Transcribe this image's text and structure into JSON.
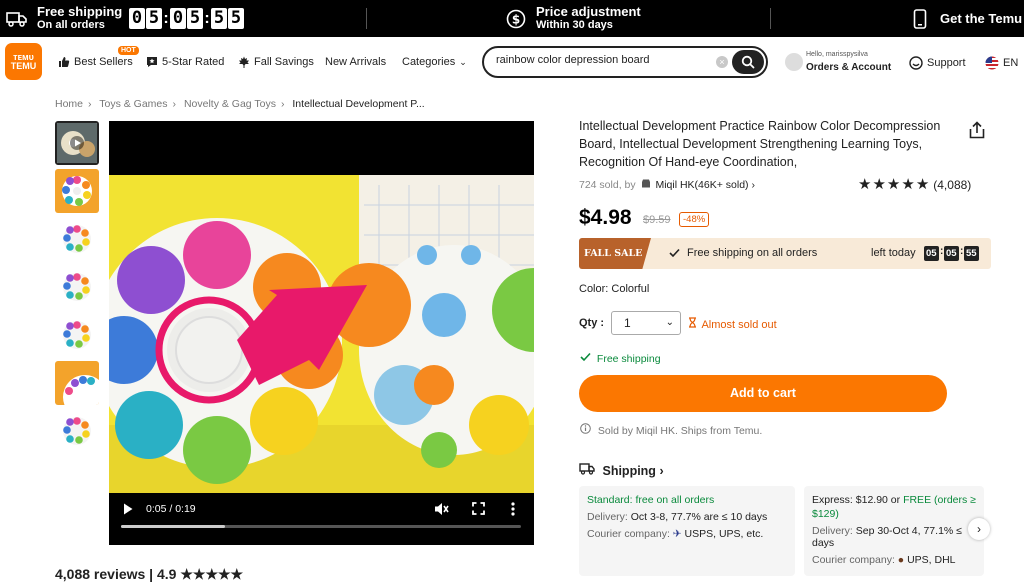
{
  "promo_bar": {
    "shipping_title": "Free shipping",
    "shipping_sub": "On all orders",
    "timer": [
      "0",
      "5",
      "0",
      "5",
      "5",
      "5"
    ],
    "price_title": "Price adjustment",
    "price_sub": "Within 30 days",
    "app_label": "Get the Temu"
  },
  "nav": {
    "logo_top": "ᴛᴇᴍᴜ",
    "logo_bottom": "TEMU",
    "hot": "HOT",
    "best_sellers": "Best Sellers",
    "five_star": "5-Star Rated",
    "fall_savings": "Fall Savings",
    "new_arrivals": "New Arrivals",
    "categories": "Categories",
    "search_value": "rainbow color depression board",
    "account_hello": "Hello, marisspysilva",
    "account_main": "Orders & Account",
    "support": "Support",
    "language": "EN"
  },
  "breadcrumb": [
    "Home",
    "Toys & Games",
    "Novelty & Gag Toys",
    "Intellectual Development P..."
  ],
  "video": {
    "time": "0:05 / 0:19",
    "progress": 0.26
  },
  "product": {
    "title": "Intellectual Development Practice Rainbow Color Decompression Board, Intellectual Development Strengthening Learning Toys, Recognition Of Hand-eye Coordination,",
    "sold": "724 sold, by",
    "store": "Miqil HK(46K+ sold)",
    "rating_count": "(4,088)",
    "stars": 5,
    "price": "$4.98",
    "old_price": "$9.59",
    "discount": "-48%",
    "sale_badge": "FALL SALE",
    "sale_free": "Free shipping on all orders",
    "left_today": "left today",
    "left_timer": [
      "05",
      "05",
      "55"
    ],
    "color_label": "Color: Colorful",
    "qty_label": "Qty :",
    "qty_value": "1",
    "almost_sold": "Almost sold out",
    "free_shipping": "Free shipping",
    "add_to_cart": "Add to cart",
    "sold_by": "Sold by Miqil HK. Ships from Temu."
  },
  "shipping": {
    "heading": "Shipping",
    "standard": {
      "title": "Standard: free on all orders",
      "delivery_label": "Delivery:",
      "delivery": "Oct 3-8, 77.7% are ≤ 10 days",
      "courier_label": "Courier company:",
      "couriers": "USPS, UPS, etc."
    },
    "express": {
      "title_prefix": "Express: $12.90 or",
      "title_free": "FREE (orders ≥",
      "title_line2": "$129)",
      "delivery_label": "Delivery:",
      "delivery": "Sep 30-Oct 4, 77.1% ≤",
      "delivery_line2": "days",
      "courier_label": "Courier company:",
      "couriers": "UPS, DHL"
    }
  },
  "reviews_partial": "4,088 reviews | 4.9 ★★★★★",
  "colors": {
    "brand_orange": "#fb7701",
    "green": "#0a8a3c",
    "fall_sale": "#b8622b"
  }
}
